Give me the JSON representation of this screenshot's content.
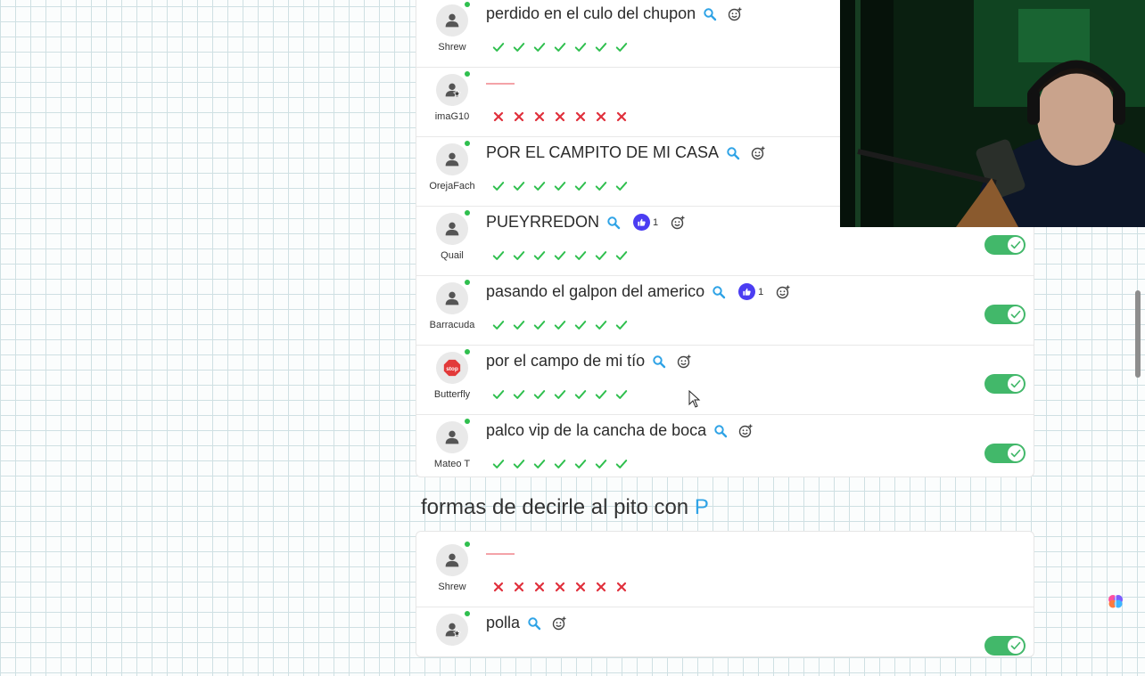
{
  "section1": {
    "rows": [
      {
        "username": "Shrew",
        "answer": "perdido en el culo del chupon",
        "avatar": "person-icon",
        "votes": [
          "check",
          "check",
          "check",
          "check",
          "check",
          "check",
          "check"
        ],
        "likes": null,
        "toggle": false
      },
      {
        "username": "imaG10",
        "answer": "",
        "avatar": "person-star-icon",
        "votes": [
          "x",
          "x",
          "x",
          "x",
          "x",
          "x",
          "x"
        ],
        "likes": null,
        "toggle": false
      },
      {
        "username": "OrejaFach",
        "answer": "POR EL CAMPITO DE MI CASA",
        "avatar": "person-icon",
        "votes": [
          "check",
          "check",
          "check",
          "check",
          "check",
          "check",
          "check"
        ],
        "likes": null,
        "toggle": false
      },
      {
        "username": "Quail",
        "answer": "PUEYRREDON",
        "avatar": "person-icon",
        "votes": [
          "check",
          "check",
          "check",
          "check",
          "check",
          "check",
          "check"
        ],
        "likes": "1",
        "toggle": true
      },
      {
        "username": "Barracuda",
        "answer": "pasando el galpon del americo",
        "avatar": "person-icon",
        "votes": [
          "check",
          "check",
          "check",
          "check",
          "check",
          "check",
          "check"
        ],
        "likes": "1",
        "toggle": true
      },
      {
        "username": "Butterfly",
        "answer": "por el campo de mi tío",
        "avatar": "stop-sign-icon",
        "votes": [
          "check",
          "check",
          "check",
          "check",
          "check",
          "check",
          "check"
        ],
        "likes": null,
        "toggle": true
      },
      {
        "username": "Mateo T",
        "answer": "palco vip de la cancha de boca",
        "avatar": "person-icon",
        "votes": [
          "check",
          "check",
          "check",
          "check",
          "check",
          "check",
          "check"
        ],
        "likes": null,
        "toggle": true
      }
    ]
  },
  "section2": {
    "title": "formas de decirle al pito con",
    "letter": "P",
    "rows": [
      {
        "username": "Shrew",
        "answer": "",
        "avatar": "person-icon",
        "votes": [
          "x",
          "x",
          "x",
          "x",
          "x",
          "x",
          "x"
        ],
        "likes": null,
        "toggle": false
      },
      {
        "username": "",
        "answer": "polla",
        "avatar": "person-star-icon",
        "votes": [],
        "likes": null,
        "toggle": true
      }
    ]
  },
  "colors": {
    "check": "#2fbf4e",
    "cross": "#e0303c",
    "toggle_on": "#42b86a",
    "like_badge": "#4b3df2",
    "search_icon": "#2fa3e6",
    "letter_highlight": "#2fa3e6"
  },
  "icons": {
    "search": "search-icon",
    "emoji": "add-reaction-icon",
    "like": "thumbs-up-icon",
    "brain": "brain-icon",
    "cursor": "mouse-cursor-icon"
  }
}
